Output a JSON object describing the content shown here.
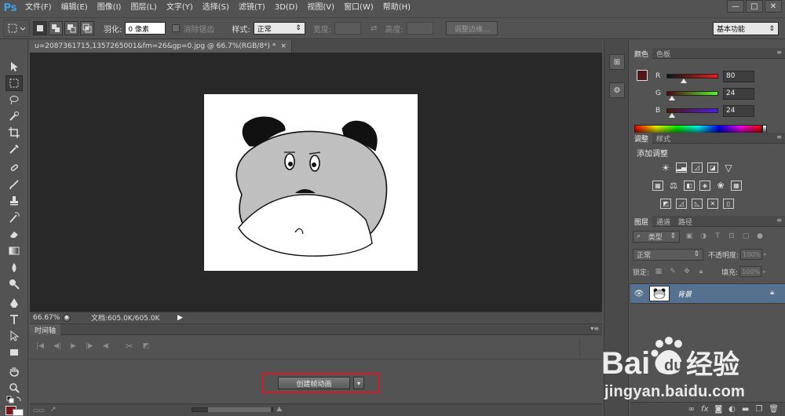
{
  "app": {
    "logo": "Ps"
  },
  "menu": [
    "文件(F)",
    "编辑(E)",
    "图像(I)",
    "图层(L)",
    "文字(Y)",
    "选择(S)",
    "滤镜(T)",
    "3D(D)",
    "视图(V)",
    "窗口(W)",
    "帮助(H)"
  ],
  "window_controls": {
    "minimize": "—",
    "restore": "□",
    "close": "✕"
  },
  "options": {
    "feather_label": "羽化:",
    "feather_value": "0 像素",
    "antialias_label": "消除锯齿",
    "style_label": "样式:",
    "style_value": "正常",
    "width_label": "宽度:",
    "height_label": "高度:",
    "refine_edge": "调整边缘...",
    "workspace": "基本功能"
  },
  "document": {
    "tab_title": "u=2087361715,1357265001&fm=26&gp=0.jpg @ 66.7%(RGB/8*) *",
    "tab_close": "×",
    "zoom": "66.67%",
    "doc_info": "文档:605.0K/605.0K"
  },
  "timeline": {
    "tab": "时间轴",
    "create_button": "创建帧动画",
    "create_dropdown": "▾"
  },
  "panels": {
    "color_tab": "颜色",
    "swatches_tab": "色板",
    "rgb": [
      {
        "channel": "R",
        "value": "80",
        "fraction": 0.314
      },
      {
        "channel": "G",
        "value": "24",
        "fraction": 0.094
      },
      {
        "channel": "B",
        "value": "24",
        "fraction": 0.094
      }
    ],
    "foreground_color": "#501818",
    "adjust_tab": "调整",
    "styles_tab": "样式",
    "add_adjustment": "添加调整",
    "layers_tab": "图层",
    "channels_tab": "通道",
    "paths_tab": "路径",
    "kind_filter": "类型",
    "blend_mode": "正常",
    "opacity_label": "不透明度:",
    "opacity_value": "100%",
    "lock_label": "锁定:",
    "fill_label": "填充:",
    "fill_value": "100%",
    "layer_name": "背景"
  },
  "watermark": {
    "brand": "Baidu经验",
    "url": "jingyan.baidu.com"
  }
}
